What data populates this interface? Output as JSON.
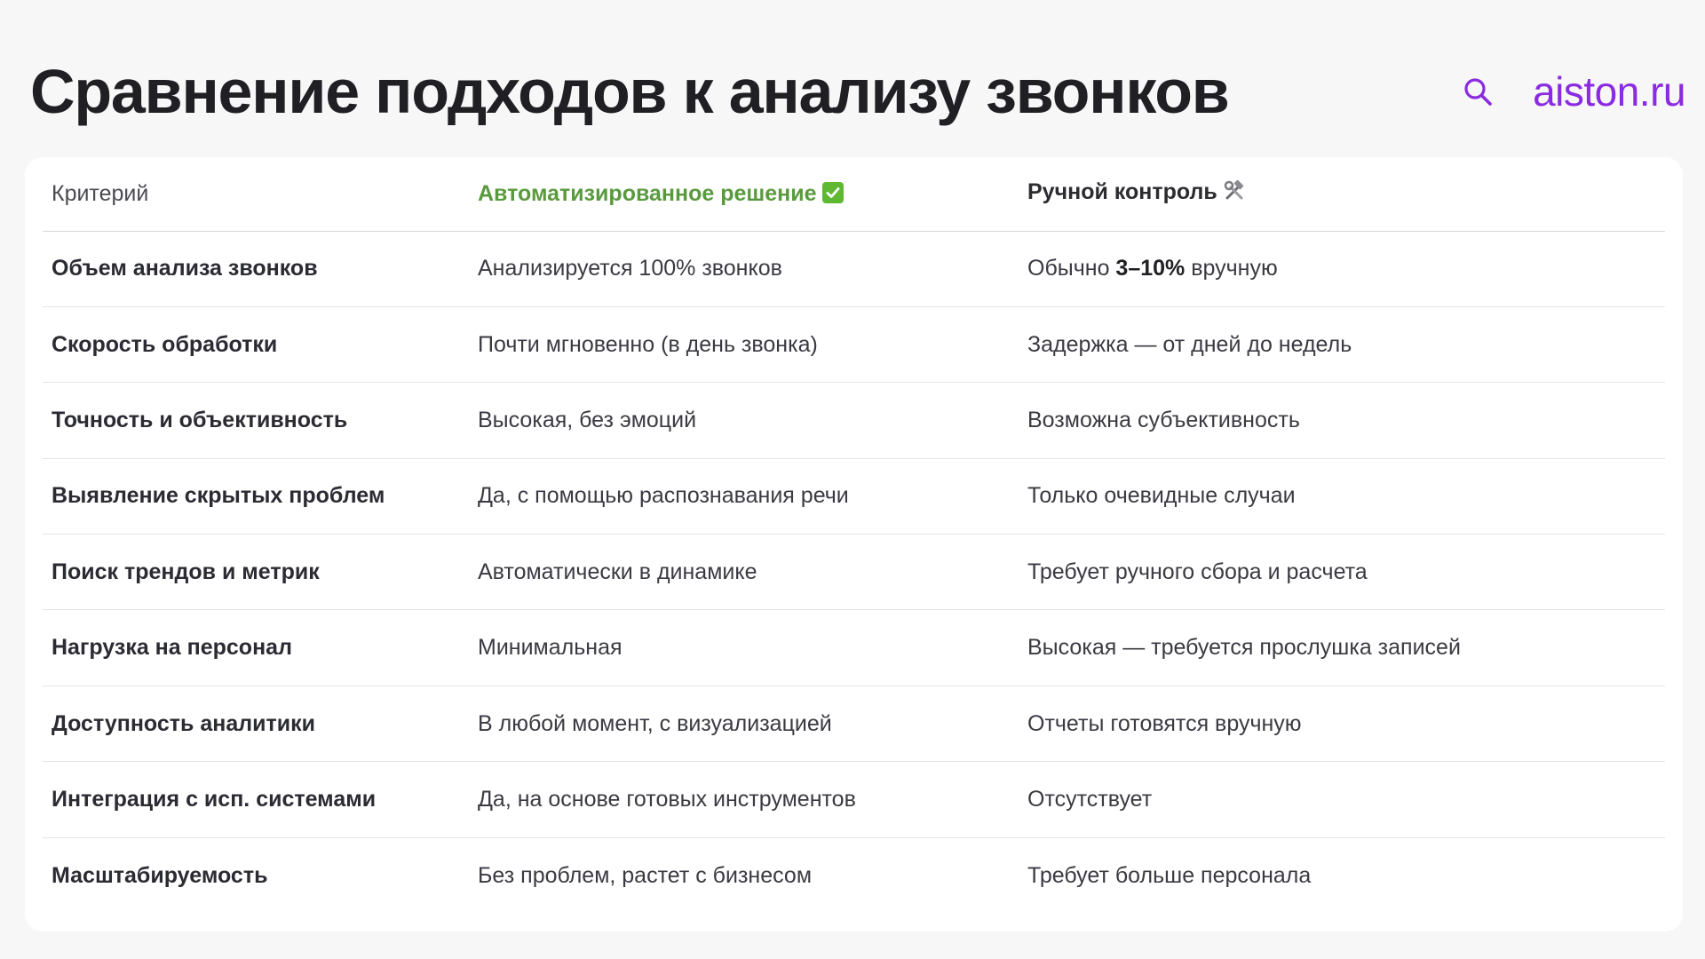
{
  "header": {
    "title": "Сравнение подходов к анализу звонков",
    "search_icon": "search-icon",
    "brand": "aiston.ru",
    "accent_color": "#8a2be2"
  },
  "table": {
    "headers": {
      "criterion": "Критерий",
      "automated": "Автоматизированное решение",
      "automated_icon": "check-mark-icon",
      "manual": "Ручной контроль",
      "manual_icon": "hammer-wrench-icon"
    },
    "colors": {
      "automated_header": "#5a9a3e"
    },
    "rows": [
      {
        "criterion": "Объем анализа звонков",
        "automated": "Анализируется 100% звонков",
        "manual_prefix": "Обычно ",
        "manual_bold": "3–10%",
        "manual_suffix": " вручную"
      },
      {
        "criterion": "Скорость обработки",
        "automated": "Почти мгновенно (в день звонка)",
        "manual": "Задержка — от дней до недель"
      },
      {
        "criterion": "Точность и объективность",
        "automated": "Высокая, без эмоций",
        "manual": "Возможна субъективность"
      },
      {
        "criterion": "Выявление скрытых проблем",
        "automated": "Да, с помощью распознавания речи",
        "manual": "Только очевидные случаи"
      },
      {
        "criterion": "Поиск трендов и метрик",
        "automated": "Автоматически в динамике",
        "manual": "Требует ручного сбора и расчета"
      },
      {
        "criterion": "Нагрузка на персонал",
        "automated": "Минимальная",
        "manual": "Высокая — требуется прослушка записей"
      },
      {
        "criterion": "Доступность аналитики",
        "automated": "В любой момент, с визуализацией",
        "manual": "Отчеты готовятся вручную"
      },
      {
        "criterion": "Интеграция с исп. системами",
        "automated": "Да, на основе готовых инструментов",
        "manual": "Отсутствует"
      },
      {
        "criterion": "Масштабируемость",
        "automated": "Без проблем, растет с бизнесом",
        "manual": "Требует больше персонала"
      }
    ]
  }
}
